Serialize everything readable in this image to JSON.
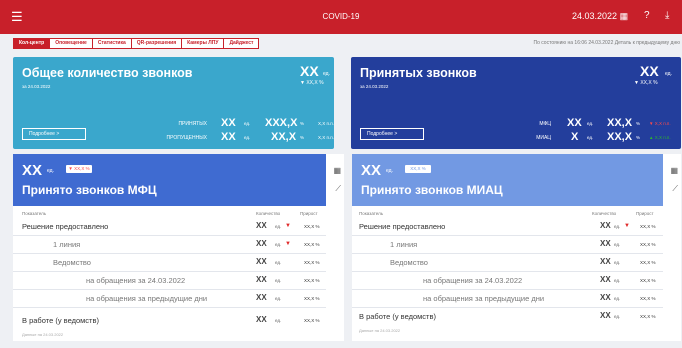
{
  "topbar": {
    "title": "COVID-19",
    "date": "24.03.2022",
    "menu_icon": "☰",
    "calendar_icon": "▦",
    "help_icon": "?",
    "download_icon": "⤓"
  },
  "tabs": [
    "Кол-центр",
    "Оповещение",
    "Статистика",
    "QR-разрешения",
    "Камеры ЛПУ",
    "Дайджест"
  ],
  "state_text": "По состоянию на 16:06 24.03.2022   Деталь к предыдущему дню",
  "card1": {
    "title": "Общее количество звонков",
    "sub": "за 24.03.2022",
    "total": "XX",
    "unit": "ед.",
    "pct": "▼ XX,X %",
    "more": "Подробнее   >",
    "rows": [
      {
        "label": "ПРИНЯТЫХ",
        "a": "XX",
        "a_unit": "ед.",
        "b": "XXX,X",
        "b_unit": "%",
        "c": "X,X п.п."
      },
      {
        "label": "ПРОПУЩЕННЫХ",
        "a": "XX",
        "a_unit": "ед.",
        "b": "XX,X",
        "b_unit": "%",
        "c": "X,X п.п."
      }
    ]
  },
  "card2": {
    "title": "Принятых звонков",
    "sub": "за 24.03.2022",
    "total": "XX",
    "unit": "ед.",
    "pct": "▼ XX,X %",
    "more": "Подробнее   >",
    "rows": [
      {
        "label": "МФЦ",
        "a": "XX",
        "a_unit": "ед.",
        "b": "XX,X",
        "b_unit": "%",
        "c": "▼ X,X п.п."
      },
      {
        "label": "МИАЦ",
        "a": "X",
        "a_unit": "ед.",
        "b": "XX,X",
        "b_unit": "%",
        "c": "▲ X,X п.п."
      }
    ]
  },
  "panel1": {
    "value": "XX",
    "unit": "ед.",
    "badge": "▼ XX,X %",
    "title": "Принято звонков МФЦ",
    "headers": {
      "name": "Показатель",
      "qty": "Количество",
      "growth": "Прирост"
    },
    "rows": [
      {
        "name": "Решение предоставлено",
        "num": "XX",
        "u": "ед.",
        "p": "XX,X %",
        "tri": "▼"
      },
      {
        "name": "1 линия",
        "num": "XX",
        "u": "ед.",
        "p": "XX,X %",
        "tri": "▼"
      },
      {
        "name": "Ведомство",
        "num": "XX",
        "u": "ед.",
        "p": "XX,X %",
        "tri": ""
      },
      {
        "name": "на обращения за 24.03.2022",
        "num": "XX",
        "u": "ед.",
        "p": "XX,X %",
        "tri": ""
      },
      {
        "name": "на обращения за предыдущие дни",
        "num": "XX",
        "u": "ед.",
        "p": "XX,X %",
        "tri": ""
      },
      {
        "name": "В работе (у ведомств)",
        "num": "XX",
        "u": "ед.",
        "p": "XX,X %",
        "tri": ""
      }
    ],
    "note": "Данные на 24.03.2022"
  },
  "panel2": {
    "value": "XX",
    "unit": "ед.",
    "badge": "XX,X %",
    "title": "Принято звонков МИАЦ",
    "headers": {
      "name": "Показатель",
      "qty": "Количество",
      "growth": "Прирост"
    },
    "rows": [
      {
        "name": "Решение предоставлено",
        "num": "XX",
        "u": "ед.",
        "p": "XX,X %",
        "tri": "▼"
      },
      {
        "name": "1 линия",
        "num": "XX",
        "u": "ед.",
        "p": "XX,X %",
        "tri": ""
      },
      {
        "name": "Ведомство",
        "num": "XX",
        "u": "ед.",
        "p": "XX,X %",
        "tri": ""
      },
      {
        "name": "на обращения за 24.03.2022",
        "num": "XX",
        "u": "ед.",
        "p": "XX,X %",
        "tri": ""
      },
      {
        "name": "на обращения за предыдущие дни",
        "num": "XX",
        "u": "ед.",
        "p": "XX,X %",
        "tri": ""
      },
      {
        "name": "В работе (у ведомств)",
        "num": "XX",
        "u": "ед.",
        "p": "XX,X %",
        "tri": ""
      }
    ],
    "note": "Данные на 24.03.2022"
  },
  "side_icons": {
    "table": "▦",
    "chart": "⟋"
  },
  "colors": {
    "brand_red": "#c8202a",
    "card1_bg": "#3aa7cc",
    "card2_bg": "#233e9c",
    "panel1_head": "#3f6bd1",
    "panel2_head": "#7299e3"
  }
}
